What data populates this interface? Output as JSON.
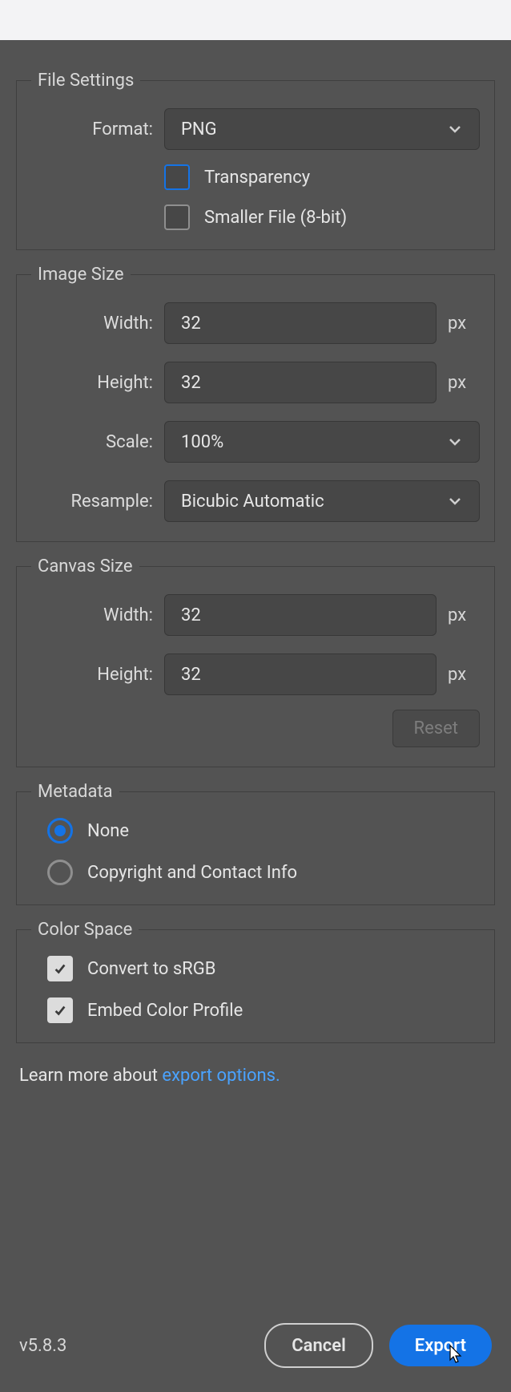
{
  "file_settings": {
    "legend": "File Settings",
    "format_label": "Format:",
    "format_value": "PNG",
    "transparency_label": "Transparency",
    "transparency_checked": false,
    "smaller_file_label": "Smaller File (8-bit)",
    "smaller_file_checked": false
  },
  "image_size": {
    "legend": "Image Size",
    "width_label": "Width:",
    "width_value": "32",
    "width_unit": "px",
    "height_label": "Height:",
    "height_value": "32",
    "height_unit": "px",
    "scale_label": "Scale:",
    "scale_value": "100%",
    "resample_label": "Resample:",
    "resample_value": "Bicubic Automatic"
  },
  "canvas_size": {
    "legend": "Canvas Size",
    "width_label": "Width:",
    "width_value": "32",
    "width_unit": "px",
    "height_label": "Height:",
    "height_value": "32",
    "height_unit": "px",
    "reset_label": "Reset"
  },
  "metadata": {
    "legend": "Metadata",
    "none_label": "None",
    "selected": "none",
    "copyright_label": "Copyright and Contact Info"
  },
  "color_space": {
    "legend": "Color Space",
    "convert_label": "Convert to sRGB",
    "convert_checked": true,
    "embed_label": "Embed Color Profile",
    "embed_checked": true
  },
  "learn": {
    "prefix": "Learn more about ",
    "link": "export options."
  },
  "footer": {
    "version": "v5.8.3",
    "cancel": "Cancel",
    "export": "Export"
  }
}
